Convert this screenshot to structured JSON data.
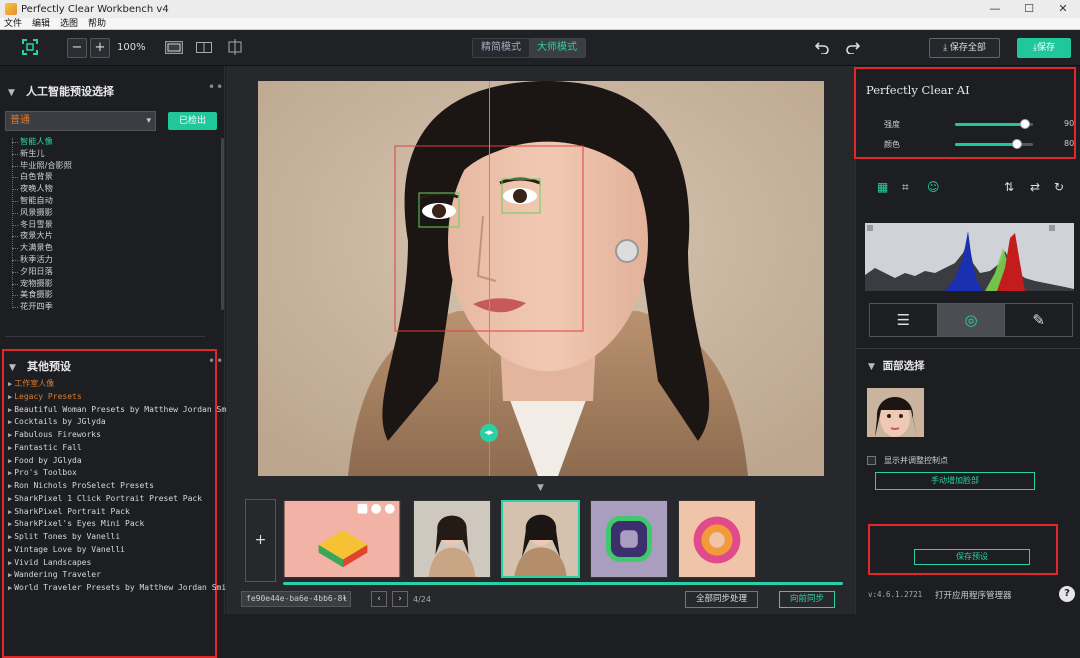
{
  "window": {
    "title": "Perfectly Clear Workbench v4",
    "controls": [
      "—",
      "☐",
      "✕"
    ]
  },
  "menu": [
    "文件",
    "编辑",
    "选图",
    "帮助"
  ],
  "toolbar": {
    "zoom_out": "−",
    "zoom_in": "+",
    "zoom_level": "100%",
    "modes": [
      {
        "label": "精简模式",
        "active": false
      },
      {
        "label": "大师模式",
        "active": true
      }
    ],
    "save_all": "保存全部",
    "save": "保存"
  },
  "left_panel": {
    "ai_presets_title": "人工智能预设选择",
    "selected_preset": "普通",
    "loaded_label": "已检出",
    "preset_tree": [
      {
        "label": "智能人像",
        "active": true
      },
      {
        "label": "新生儿"
      },
      {
        "label": "毕业照/合影照"
      },
      {
        "label": "白色背景"
      },
      {
        "label": "夜晚人物"
      },
      {
        "label": "智能自动"
      },
      {
        "label": "风景摄影"
      },
      {
        "label": "冬日雪景"
      },
      {
        "label": "夜景大片"
      },
      {
        "label": "大满景色"
      },
      {
        "label": "秋季活力"
      },
      {
        "label": "夕阳日落"
      },
      {
        "label": "宠物摄影"
      },
      {
        "label": "美食摄影"
      },
      {
        "label": "花开四季"
      }
    ],
    "other_presets_title": "其他预设",
    "other_presets": [
      {
        "label": "工作室人像",
        "active": true
      },
      {
        "label": "Legacy Presets",
        "active": true
      },
      {
        "label": "Beautiful Woman Presets by Matthew Jordan Smith"
      },
      {
        "label": "Cocktails by JGlyda"
      },
      {
        "label": "Fabulous Fireworks"
      },
      {
        "label": "Fantastic Fall"
      },
      {
        "label": "Food by JGlyda"
      },
      {
        "label": "Pro's Toolbox"
      },
      {
        "label": "Ron Nichols ProSelect Presets"
      },
      {
        "label": "SharkPixel 1 Click Portrait Preset Pack"
      },
      {
        "label": "SharkPixel Portrait Pack"
      },
      {
        "label": "SharkPixel's Eyes Mini Pack"
      },
      {
        "label": "Split Tones by Vanelli"
      },
      {
        "label": "Vintage Love by Vanelli"
      },
      {
        "label": "Vivid Landscapes"
      },
      {
        "label": "Wandering Traveler"
      },
      {
        "label": "World Traveler Presets by Matthew Jordan Smith"
      }
    ]
  },
  "canvas": {
    "filename": "fe90e44e-ba6e-4bb6-8l",
    "page_counter": "4/24",
    "sync_all": "全部同步处理",
    "sync_forward": "向前同步",
    "add_label": "+",
    "selected_thumb_index": 2
  },
  "right_panel": {
    "ai_title": "Perfectly Clear AI",
    "sliders": [
      {
        "label": "强度",
        "value": 90
      },
      {
        "label": "颜色",
        "value": 80
      }
    ],
    "face_title": "面部选择",
    "show_points_label": "显示并调整控制点",
    "add_face_label": "手动增加脸部",
    "save_preset_label": "保存预设",
    "version": "v:4.6.1.2721",
    "open_manager": "打开应用程序管理器",
    "help": "?"
  },
  "colors": {
    "accent": "#1fc79b",
    "highlight_box": "#e02828",
    "preset_active": "#e07a2a"
  }
}
